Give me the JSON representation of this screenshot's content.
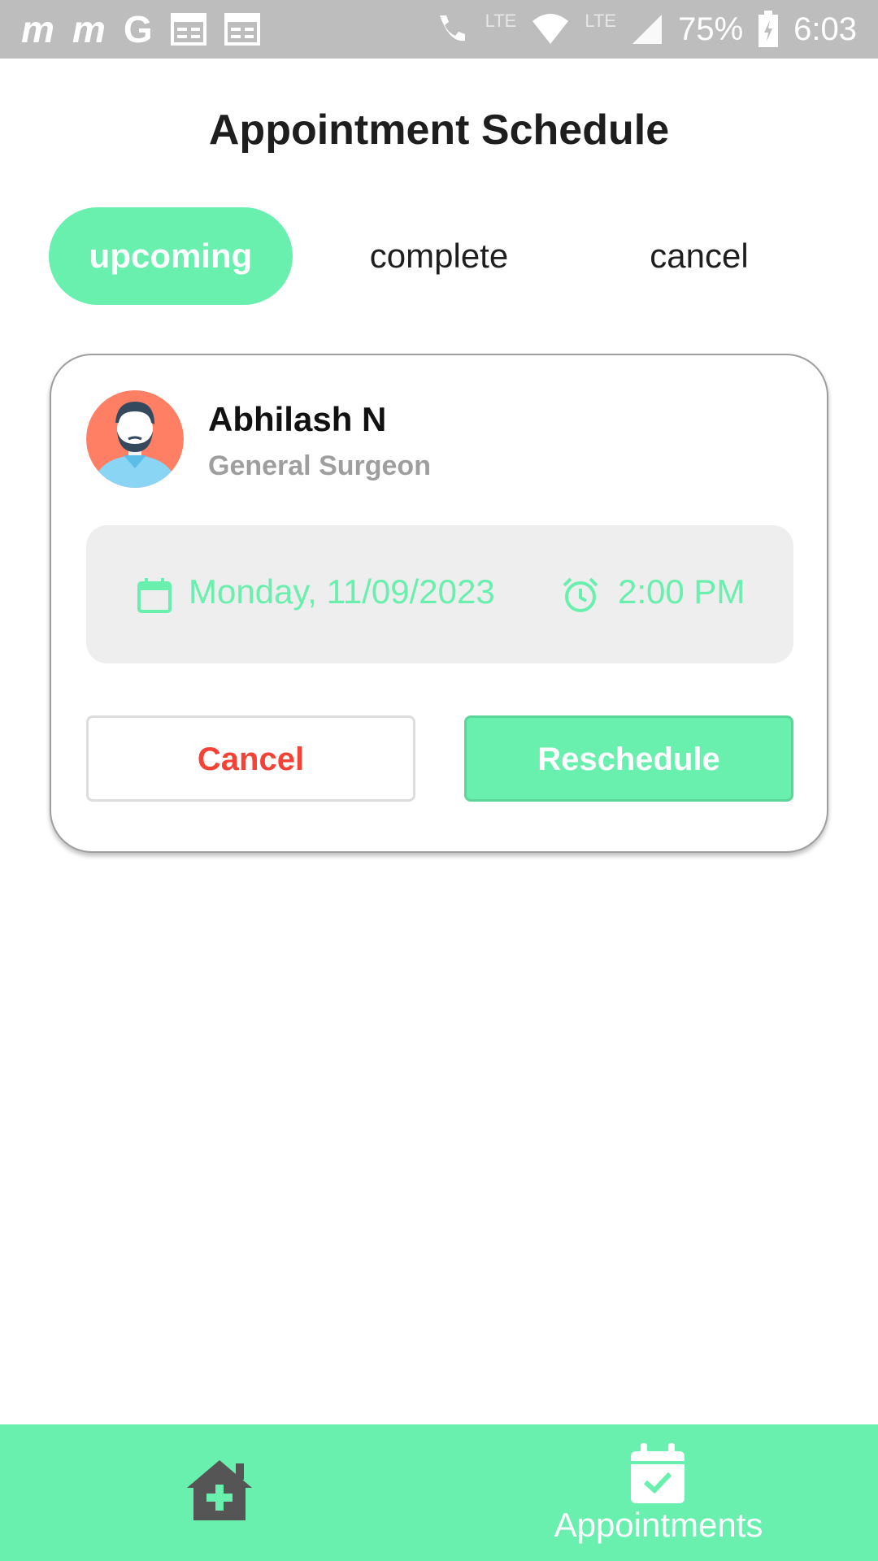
{
  "status_bar": {
    "left_icons": [
      "m",
      "m",
      "G"
    ],
    "battery": "75%",
    "time": "6:03",
    "lte_1": "LTE",
    "lte_2": "LTE"
  },
  "page": {
    "title": "Appointment Schedule"
  },
  "tabs": [
    {
      "label": "upcoming",
      "active": true
    },
    {
      "label": "complete",
      "active": false
    },
    {
      "label": "cancel",
      "active": false
    }
  ],
  "appointment": {
    "doctor_name": "Abhilash N",
    "specialty": "General Surgeon",
    "date": "Monday, 11/09/2023",
    "time": "2:00 PM",
    "cancel_label": "Cancel",
    "reschedule_label": "Reschedule"
  },
  "bottom_nav": {
    "home_icon": "home-medical-icon",
    "appointments_label": "Appointments"
  },
  "colors": {
    "accent": "#69efae",
    "cancel_red": "#f44336",
    "status_bar": "#bdbdbd"
  }
}
